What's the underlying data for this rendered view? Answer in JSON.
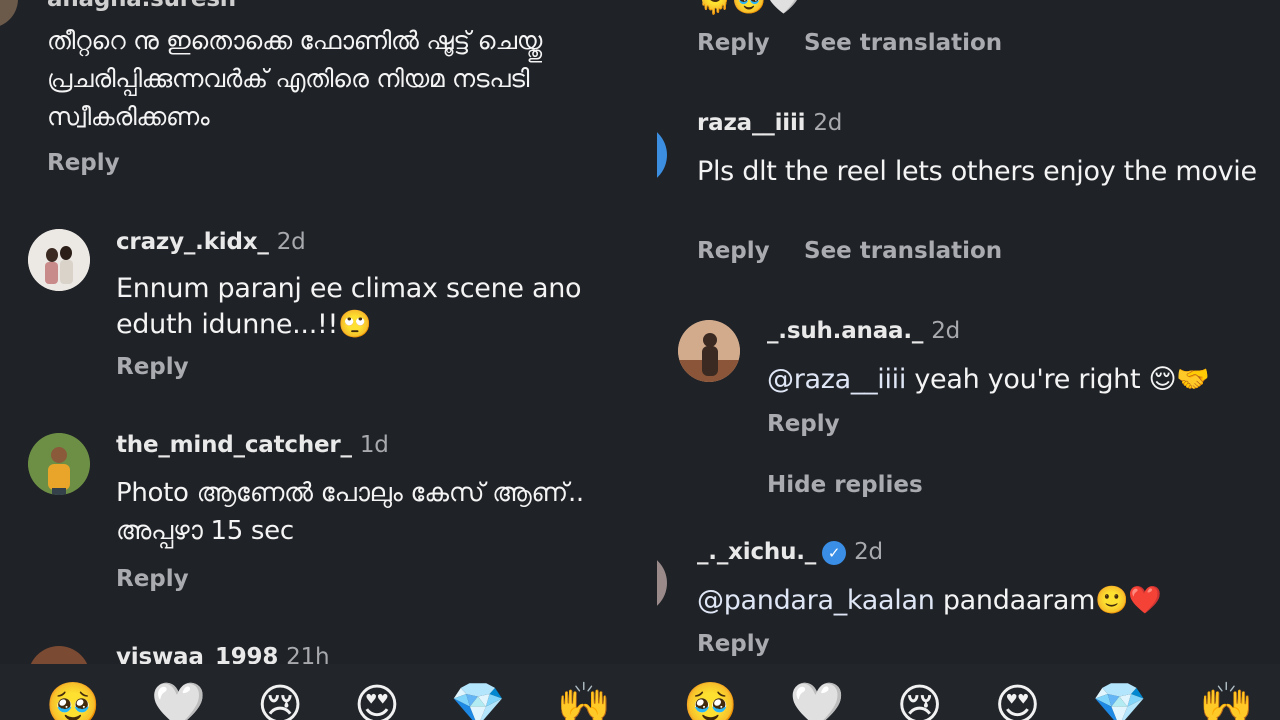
{
  "left": {
    "top_comment": {
      "username": "anagha.suresh",
      "text": "തീറ്ററെ നു ഇതൊക്കെ ഫോണിൽ ഷൂട്ട് ചെയ്തു പ്രചരിപ്പിക്കുന്നവർക് എതിരെ നിയമ നടപടി സ്വീകരിക്കണം",
      "reply": "Reply"
    },
    "comments": [
      {
        "username": "crazy_.kidx_",
        "time": "2d",
        "text": "Ennum paranj ee climax scene ano eduth idunne...!!🙄",
        "reply": "Reply"
      },
      {
        "username": "the_mind_catcher_",
        "time": "1d",
        "text": "Photo ആണേൽ പോലും കേസ് ആണ്.. അപ്പഴാ 15 sec",
        "reply": "Reply"
      },
      {
        "username": "viswaa_1998",
        "time": "21h"
      }
    ],
    "reactions": [
      "🥹",
      "🤍",
      "😢",
      "😍",
      "💎",
      "🙌"
    ]
  },
  "right": {
    "top_emojis": "🫠🥹🤍",
    "top_actions": {
      "reply": "Reply",
      "translate": "See translation"
    },
    "comments": [
      {
        "username": "raza__iiii",
        "time": "2d",
        "text": "Pls dlt the reel lets others enjoy the movie",
        "reply": "Reply",
        "translate": "See translation"
      },
      {
        "username": "_.suh.anaa._",
        "time": "2d",
        "mention": "@raza__iiii",
        "text": " yeah you're right 😌🤝",
        "reply": "Reply"
      },
      {
        "hide_replies": "Hide replies"
      },
      {
        "username": "_._xichu._",
        "time": "2d",
        "mention": "@pandara_kaalan",
        "text": " pandaaram🙂❤️",
        "reply": "Reply"
      }
    ],
    "reactions": [
      "🥹",
      "🤍",
      "😢",
      "😍",
      "💎",
      "🙌"
    ]
  },
  "colors": {
    "background": "#1f2227",
    "text": "#f4f4f4",
    "muted": "#a9abb0",
    "verified": "#3a8ee6"
  }
}
